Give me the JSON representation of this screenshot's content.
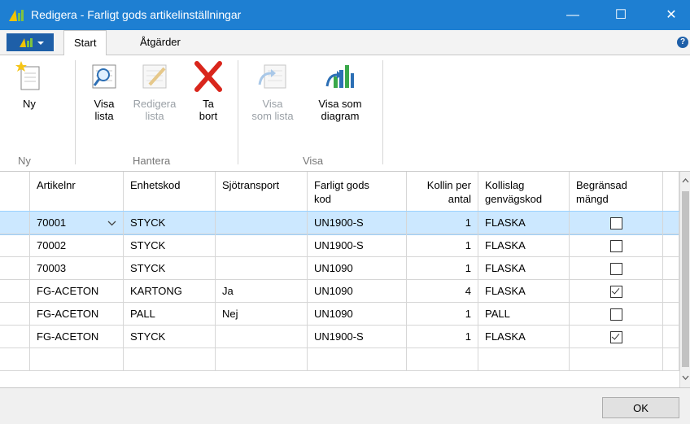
{
  "window": {
    "title": "Redigera - Farligt gods artikelinställningar",
    "minimize_glyph": "—",
    "maximize_glyph": "☐",
    "close_glyph": "✕"
  },
  "ribbon": {
    "tabs": [
      "Start",
      "Åtgärder"
    ],
    "active_tab": "Start",
    "help_glyph": "?",
    "groups": [
      {
        "label": "Ny",
        "buttons": [
          {
            "label": "Ny",
            "icon": "new-document-icon",
            "enabled": true
          }
        ]
      },
      {
        "label": "Hantera",
        "buttons": [
          {
            "label": "Visa\nlista",
            "icon": "view-list-icon",
            "enabled": true
          },
          {
            "label": "Redigera\nlista",
            "icon": "edit-list-icon",
            "enabled": false
          },
          {
            "label": "Ta\nbort",
            "icon": "delete-icon",
            "enabled": true
          }
        ]
      },
      {
        "label": "Visa",
        "buttons": [
          {
            "label": "Visa\nsom lista",
            "icon": "show-as-list-icon",
            "enabled": false
          },
          {
            "label": "Visa som\ndiagram",
            "icon": "show-as-chart-icon",
            "enabled": true
          }
        ]
      }
    ]
  },
  "grid": {
    "columns": [
      {
        "label": "Artikelnr"
      },
      {
        "label": "Enhetskod"
      },
      {
        "label": "Sjötransport"
      },
      {
        "label": "Farligt gods\nkod"
      },
      {
        "label": "Kollin per\nantal"
      },
      {
        "label": "Kollislag\ngenvägskod"
      },
      {
        "label": "Begränsad\nmängd"
      }
    ],
    "rows": [
      {
        "artikelnr": "70001",
        "enhetskod": "STYCK",
        "sjotransport": "",
        "farligt_gods_kod": "UN1900-S",
        "kollin_per_antal": "1",
        "kollislag": "FLASKA",
        "begransad": false,
        "selected": true
      },
      {
        "artikelnr": "70002",
        "enhetskod": "STYCK",
        "sjotransport": "",
        "farligt_gods_kod": "UN1900-S",
        "kollin_per_antal": "1",
        "kollislag": "FLASKA",
        "begransad": false,
        "selected": false
      },
      {
        "artikelnr": "70003",
        "enhetskod": "STYCK",
        "sjotransport": "",
        "farligt_gods_kod": "UN1090",
        "kollin_per_antal": "1",
        "kollislag": "FLASKA",
        "begransad": false,
        "selected": false
      },
      {
        "artikelnr": "FG-ACETON",
        "enhetskod": "KARTONG",
        "sjotransport": "Ja",
        "farligt_gods_kod": "UN1090",
        "kollin_per_antal": "4",
        "kollislag": "FLASKA",
        "begransad": true,
        "selected": false
      },
      {
        "artikelnr": "FG-ACETON",
        "enhetskod": "PALL",
        "sjotransport": "Nej",
        "farligt_gods_kod": "UN1090",
        "kollin_per_antal": "1",
        "kollislag": "PALL",
        "begransad": false,
        "selected": false
      },
      {
        "artikelnr": "FG-ACETON",
        "enhetskod": "STYCK",
        "sjotransport": "",
        "farligt_gods_kod": "UN1900-S",
        "kollin_per_antal": "1",
        "kollislag": "FLASKA",
        "begransad": true,
        "selected": false
      }
    ]
  },
  "footer": {
    "ok_label": "OK"
  },
  "colors": {
    "titlebar": "#1e7fd2",
    "selection": "#cce8ff",
    "selection_border": "#99d1ff"
  }
}
